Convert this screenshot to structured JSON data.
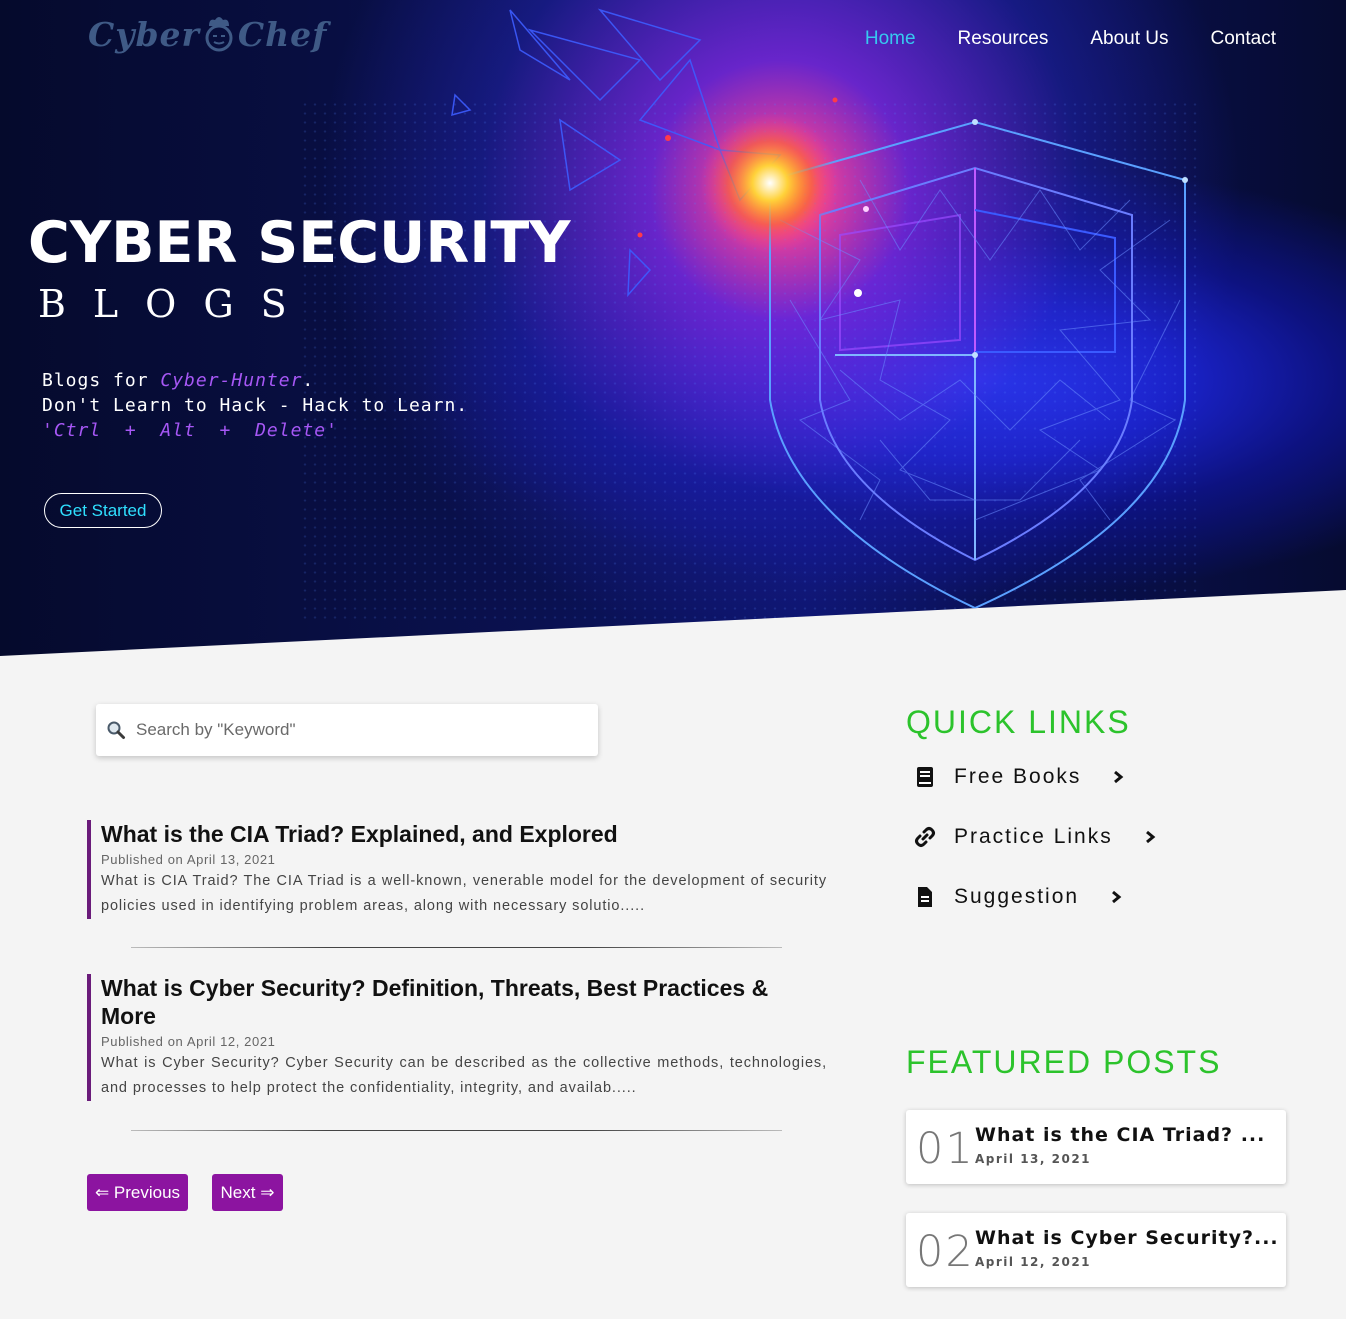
{
  "brand": {
    "logo_left": "Cyber",
    "logo_right": "Chef"
  },
  "nav": {
    "items": [
      {
        "label": "Home",
        "active": true
      },
      {
        "label": "Resources",
        "active": false
      },
      {
        "label": "About Us",
        "active": false
      },
      {
        "label": "Contact",
        "active": false
      }
    ]
  },
  "hero": {
    "title": "CYBER SECURITY",
    "subtitle": "BLOGS",
    "line1_prefix": "Blogs for ",
    "line1_highlight": "Cyber-Hunter",
    "line1_suffix": ".",
    "line2": "Don't Learn to Hack - Hack to Learn.",
    "line3": "'Ctrl  +  Alt  +  Delete'",
    "cta": "Get Started"
  },
  "search": {
    "placeholder": "Search by \"Keyword\""
  },
  "posts": [
    {
      "title": "What is the CIA Triad? Explained, and Explored",
      "date": "Published on April 13, 2021",
      "excerpt": "What is CIA Traid? The CIA Triad is a well-known, venerable model for the development of security policies used in identifying problem areas, along with necessary solutio....."
    },
    {
      "title": "What is Cyber Security? Definition, Threats, Best Practices & More",
      "date": "Published on April 12, 2021",
      "excerpt": "What is Cyber Security? Cyber Security can be described as the collective methods, technologies, and processes to help protect the confidentiality, integrity, and availab....."
    }
  ],
  "pagination": {
    "previous": "⇐ Previous",
    "next": "Next ⇒"
  },
  "quick_links": {
    "heading": "QUICK LINKS",
    "items": [
      {
        "label": "Free Books",
        "icon": "book-icon"
      },
      {
        "label": "Practice Links",
        "icon": "link-icon"
      },
      {
        "label": "Suggestion",
        "icon": "document-icon"
      }
    ]
  },
  "featured": {
    "heading": "FEATURED POSTS",
    "items": [
      {
        "num": "01",
        "title": "What is the CIA Triad? ...",
        "date": "April 13, 2021"
      },
      {
        "num": "02",
        "title": "What is Cyber Security?...",
        "date": "April 12, 2021"
      }
    ]
  },
  "colors": {
    "accent_purple": "#8c14a0",
    "heading_green": "#2cc32c",
    "nav_active": "#37c8f0"
  }
}
